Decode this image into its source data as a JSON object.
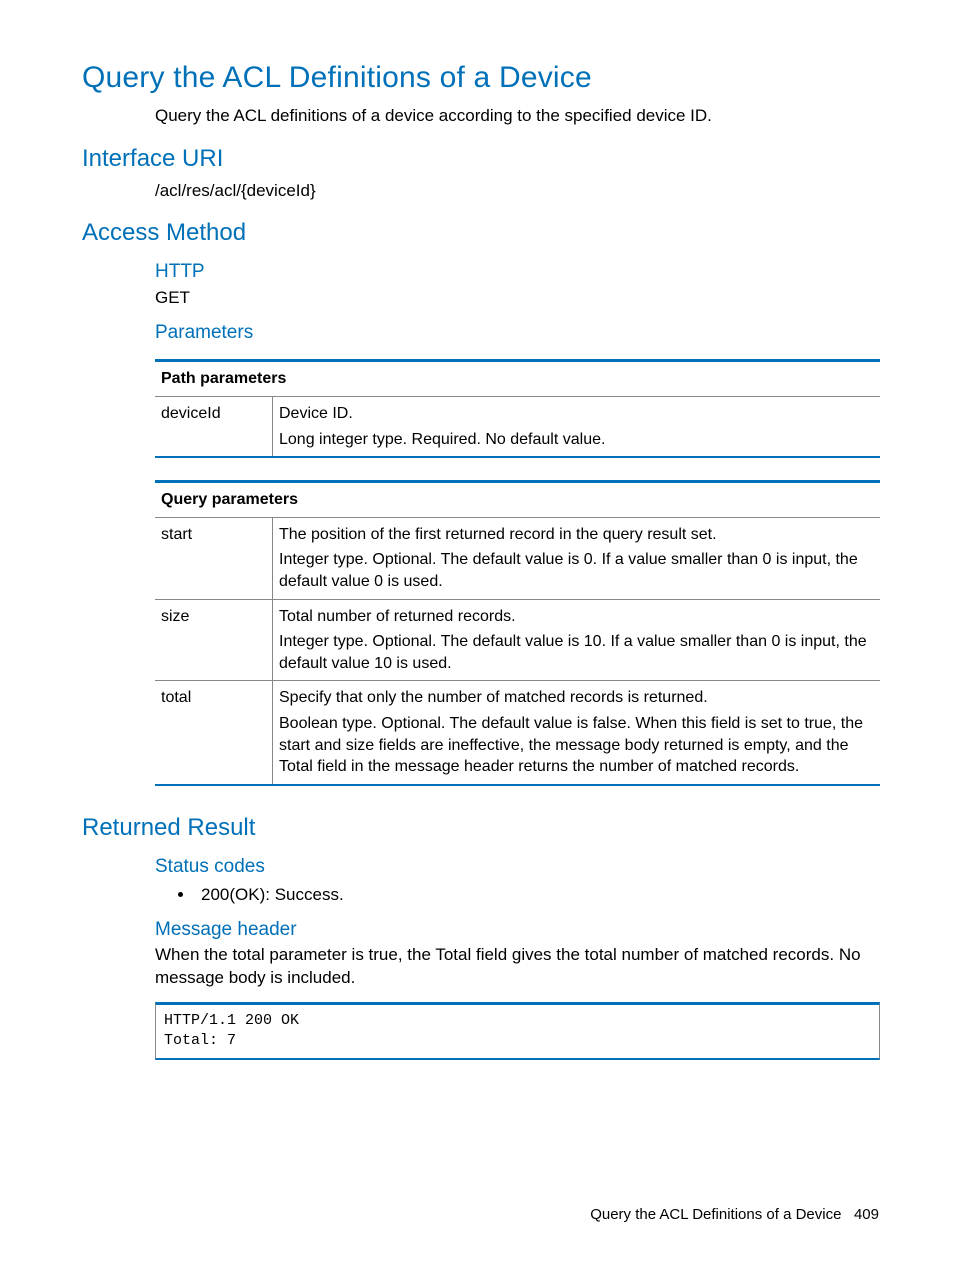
{
  "title": "Query the ACL Definitions of a Device",
  "lead": "Query the ACL definitions of a device according to the specified device ID.",
  "sections": {
    "interface_uri": {
      "heading": "Interface URI",
      "value": "/acl/res/acl/{deviceId}"
    },
    "access_method": {
      "heading": "Access Method",
      "http_heading": "HTTP",
      "http_method": "GET",
      "parameters_heading": "Parameters"
    },
    "returned_result": {
      "heading": "Returned Result",
      "status_codes_heading": "Status codes",
      "status_codes": [
        "200(OK): Success."
      ],
      "message_header_heading": "Message header",
      "message_header_text": "When the total parameter is true, the Total field gives the total number of matched records. No message body is included.",
      "code": "HTTP/1.1 200 OK\nTotal: 7"
    }
  },
  "tables": {
    "path_params": {
      "header": "Path parameters",
      "rows": [
        {
          "name": "deviceId",
          "desc": [
            "Device ID.",
            "Long integer type. Required. No default value."
          ]
        }
      ]
    },
    "query_params": {
      "header": "Query parameters",
      "rows": [
        {
          "name": "start",
          "desc": [
            "The position of the first returned record in the query result set.",
            "Integer type. Optional. The default value is 0. If a value smaller than 0 is input, the default value 0 is used."
          ]
        },
        {
          "name": "size",
          "desc": [
            "Total number of returned records.",
            "Integer type. Optional. The default value is 10. If a value smaller than 0 is input, the default value 10 is used."
          ]
        },
        {
          "name": "total",
          "desc": [
            "Specify that only the number of matched records is returned.",
            "Boolean type. Optional. The default value is false. When this field is set to true, the start and size fields are ineffective, the message body returned is empty, and the Total field in the message header returns the number of matched records."
          ]
        }
      ]
    }
  },
  "footer": {
    "title": "Query the ACL Definitions of a Device",
    "page": "409"
  }
}
